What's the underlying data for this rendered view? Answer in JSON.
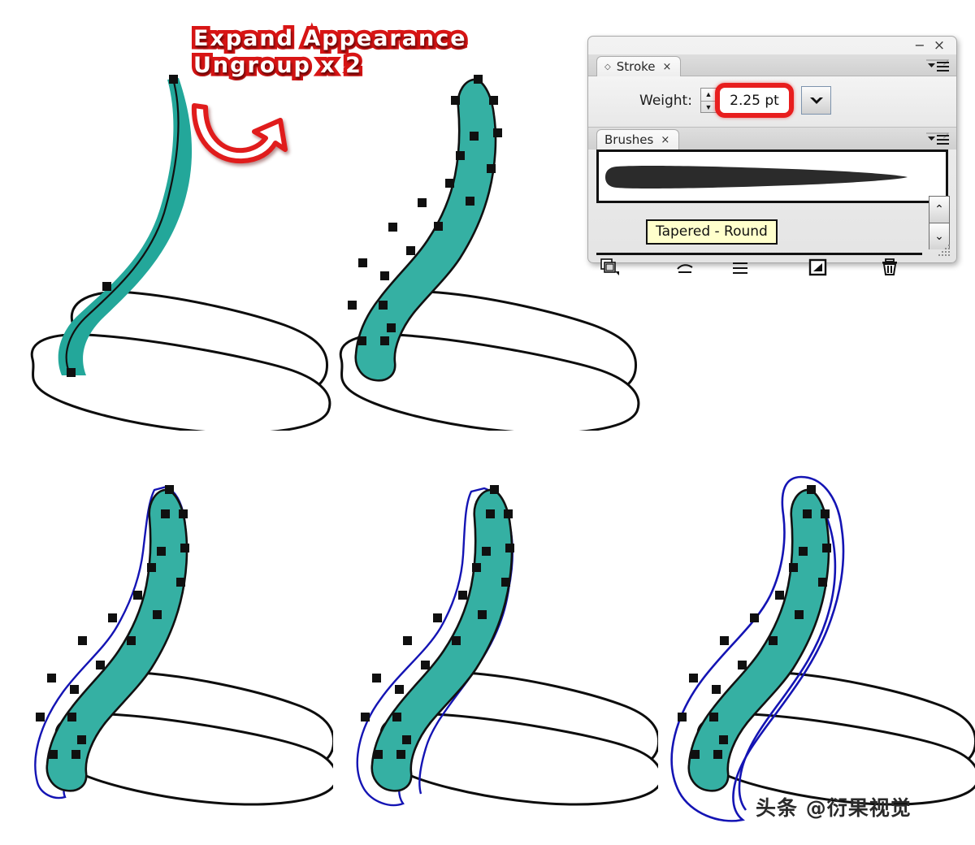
{
  "annotation": {
    "line1": "Expand Appearance",
    "line2": "Ungroup x 2",
    "arrow_icon": "curved-arrow-icon",
    "color": "#d81515",
    "inner_color": "#ffffff"
  },
  "panel": {
    "minimize_label": "−",
    "close_label": "×",
    "menu_icon": "panel-menu-icon",
    "resize_grip_icon": "resize-grip-icon",
    "stroke": {
      "tab_label": "Stroke",
      "tab_diamond_icon": "diamond-icon",
      "tab_close_label": "×",
      "weight_label": "Weight:",
      "weight_value": "2.25 pt",
      "weight_unit": "pt",
      "stepper_up": "▲",
      "stepper_down": "▼",
      "dropdown_icon": "chevron-down-icon",
      "highlight_color": "#e81e1e"
    },
    "brushes": {
      "tab_label": "Brushes",
      "tab_close_label": "×",
      "swatch_name": "tapered-round-brush-swatch",
      "tooltip": "Tapered - Round",
      "scroll_up": "⌃",
      "scroll_down": "⌄",
      "footer_icons": [
        {
          "name": "brush-libraries-icon"
        },
        {
          "name": "remove-brush-stroke-icon"
        },
        {
          "name": "options-of-selected-object-icon"
        },
        {
          "name": "new-brush-icon"
        },
        {
          "name": "delete-brush-icon"
        }
      ]
    }
  },
  "illustrations": [
    {
      "id": "step-1",
      "caption_name": "brush-stroke-with-path",
      "shape_fill": "#23a79a",
      "has_path_line": true,
      "anchor_count": 3,
      "blue_outline": false
    },
    {
      "id": "step-2",
      "caption_name": "expanded-outline-shape",
      "shape_fill": "#23a79a",
      "has_path_line": false,
      "anchor_count": 22,
      "blue_outline": false
    },
    {
      "id": "step-3",
      "caption_name": "offset-path-small",
      "shape_fill": "#23a79a",
      "has_path_line": false,
      "anchor_count": 22,
      "blue_outline": true,
      "outline_color": "#1414b4",
      "offset": "small"
    },
    {
      "id": "step-4",
      "caption_name": "offset-path-medium",
      "shape_fill": "#23a79a",
      "has_path_line": false,
      "anchor_count": 22,
      "blue_outline": true,
      "outline_color": "#1414b4",
      "offset": "medium"
    },
    {
      "id": "step-5",
      "caption_name": "offset-path-large",
      "shape_fill": "#23a79a",
      "has_path_line": false,
      "anchor_count": 22,
      "blue_outline": true,
      "outline_color": "#1414b4",
      "offset": "large"
    }
  ],
  "watermark": "头条 @衍果视觉"
}
